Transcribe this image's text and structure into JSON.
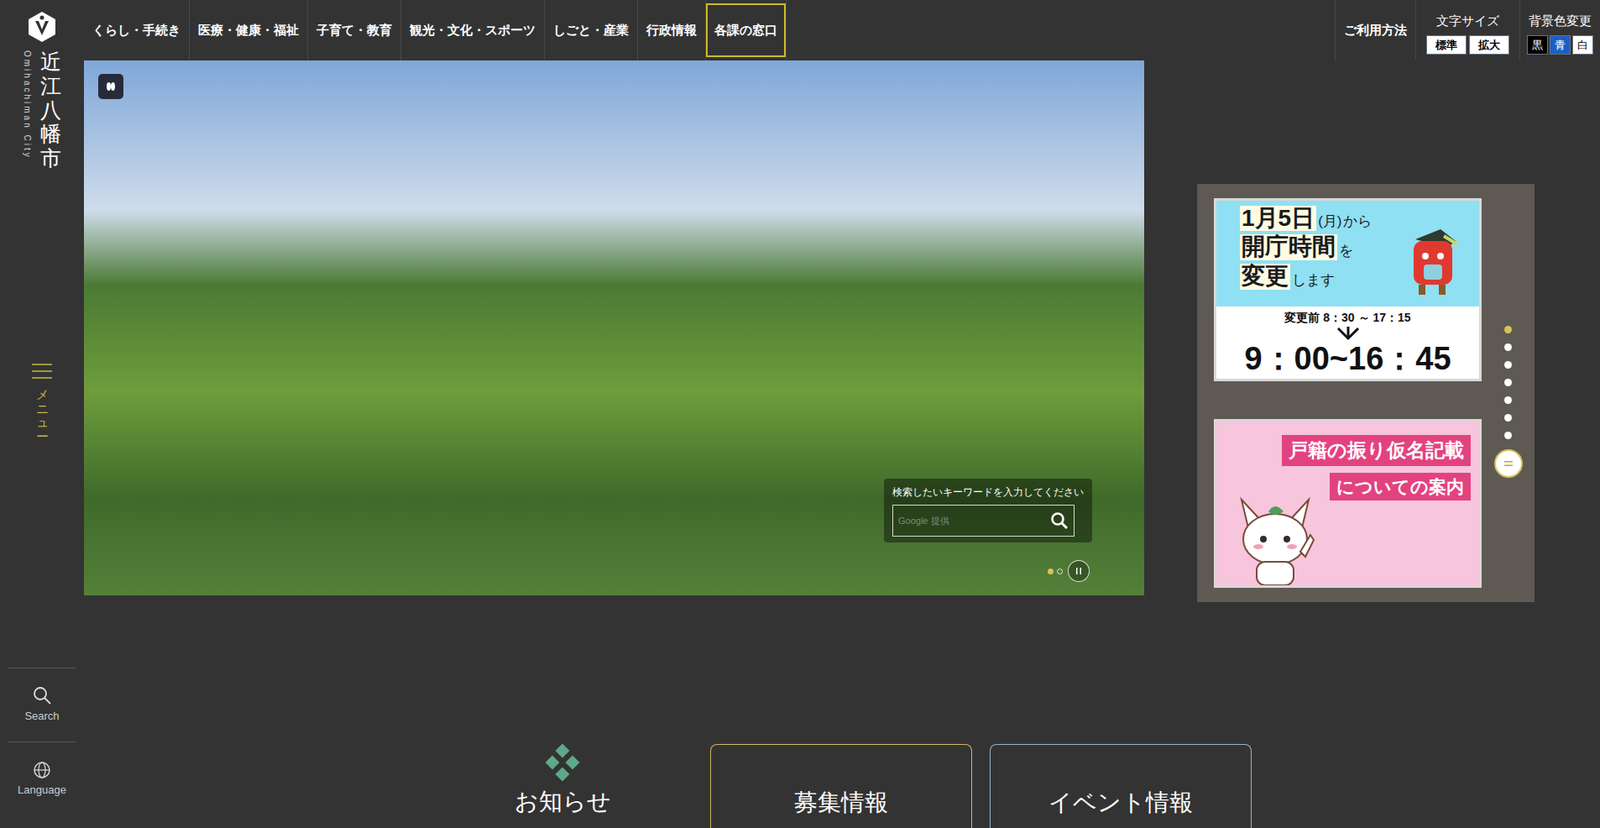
{
  "logo": {
    "name": "近江八幡市",
    "romaji": "Omihachiman City"
  },
  "nav": [
    {
      "label": "くらし・手続き",
      "selected": false
    },
    {
      "label": "医療・健康・福祉",
      "selected": false
    },
    {
      "label": "子育て・教育",
      "selected": false
    },
    {
      "label": "観光・文化・スポーツ",
      "selected": false
    },
    {
      "label": "しごと・産業",
      "selected": false
    },
    {
      "label": "行政情報",
      "selected": false
    },
    {
      "label": "各課の窓口",
      "selected": true
    }
  ],
  "utility": {
    "guide": "ご利用方法",
    "font_size": {
      "label": "文字サイズ",
      "options": [
        "標準",
        "拡大"
      ]
    },
    "bg_color": {
      "label": "背景色変更",
      "options": [
        {
          "label": "黒",
          "color": "#000000"
        },
        {
          "label": "青",
          "color": "#1a5fc8"
        },
        {
          "label": "白",
          "color": "#ffffff"
        }
      ]
    }
  },
  "sidebar": {
    "menu": "メニュー",
    "search": "Search",
    "language": "Language"
  },
  "hero": {
    "search_label": "検索したいキーワードを入力してください",
    "search_placeholder": "Google 提供",
    "slides": [
      {
        "selected": true
      },
      {
        "selected": false
      }
    ]
  },
  "banners": [
    {
      "kind": "schedule",
      "lines": [
        [
          {
            "text": "1月5日",
            "big": true
          },
          {
            "text": "(月)",
            "big": false
          },
          {
            "text": "から",
            "big": false
          }
        ],
        [
          {
            "text": "開庁時間",
            "big": true
          },
          {
            "text": "を",
            "big": false
          }
        ],
        [
          {
            "text": "変更",
            "big": true
          },
          {
            "text": "します",
            "big": false
          }
        ]
      ],
      "before": "変更前 8：30 ～ 17：15",
      "after": "9：00~16：45"
    },
    {
      "kind": "notice",
      "lines": [
        "戸籍の振り仮名記載",
        "についての案内"
      ]
    }
  ],
  "banner_dots": [
    {
      "selected": true
    },
    {
      "selected": false
    },
    {
      "selected": false
    },
    {
      "selected": false
    },
    {
      "selected": false
    },
    {
      "selected": false
    },
    {
      "selected": false
    }
  ],
  "sections": [
    {
      "kind": "heading",
      "label": "お知らせ",
      "color": "#5fa88a"
    },
    {
      "kind": "card",
      "label": "募集情報",
      "color": "#d9b26a"
    },
    {
      "kind": "card",
      "label": "イベント情報",
      "color": "#8fb8cc"
    }
  ]
}
